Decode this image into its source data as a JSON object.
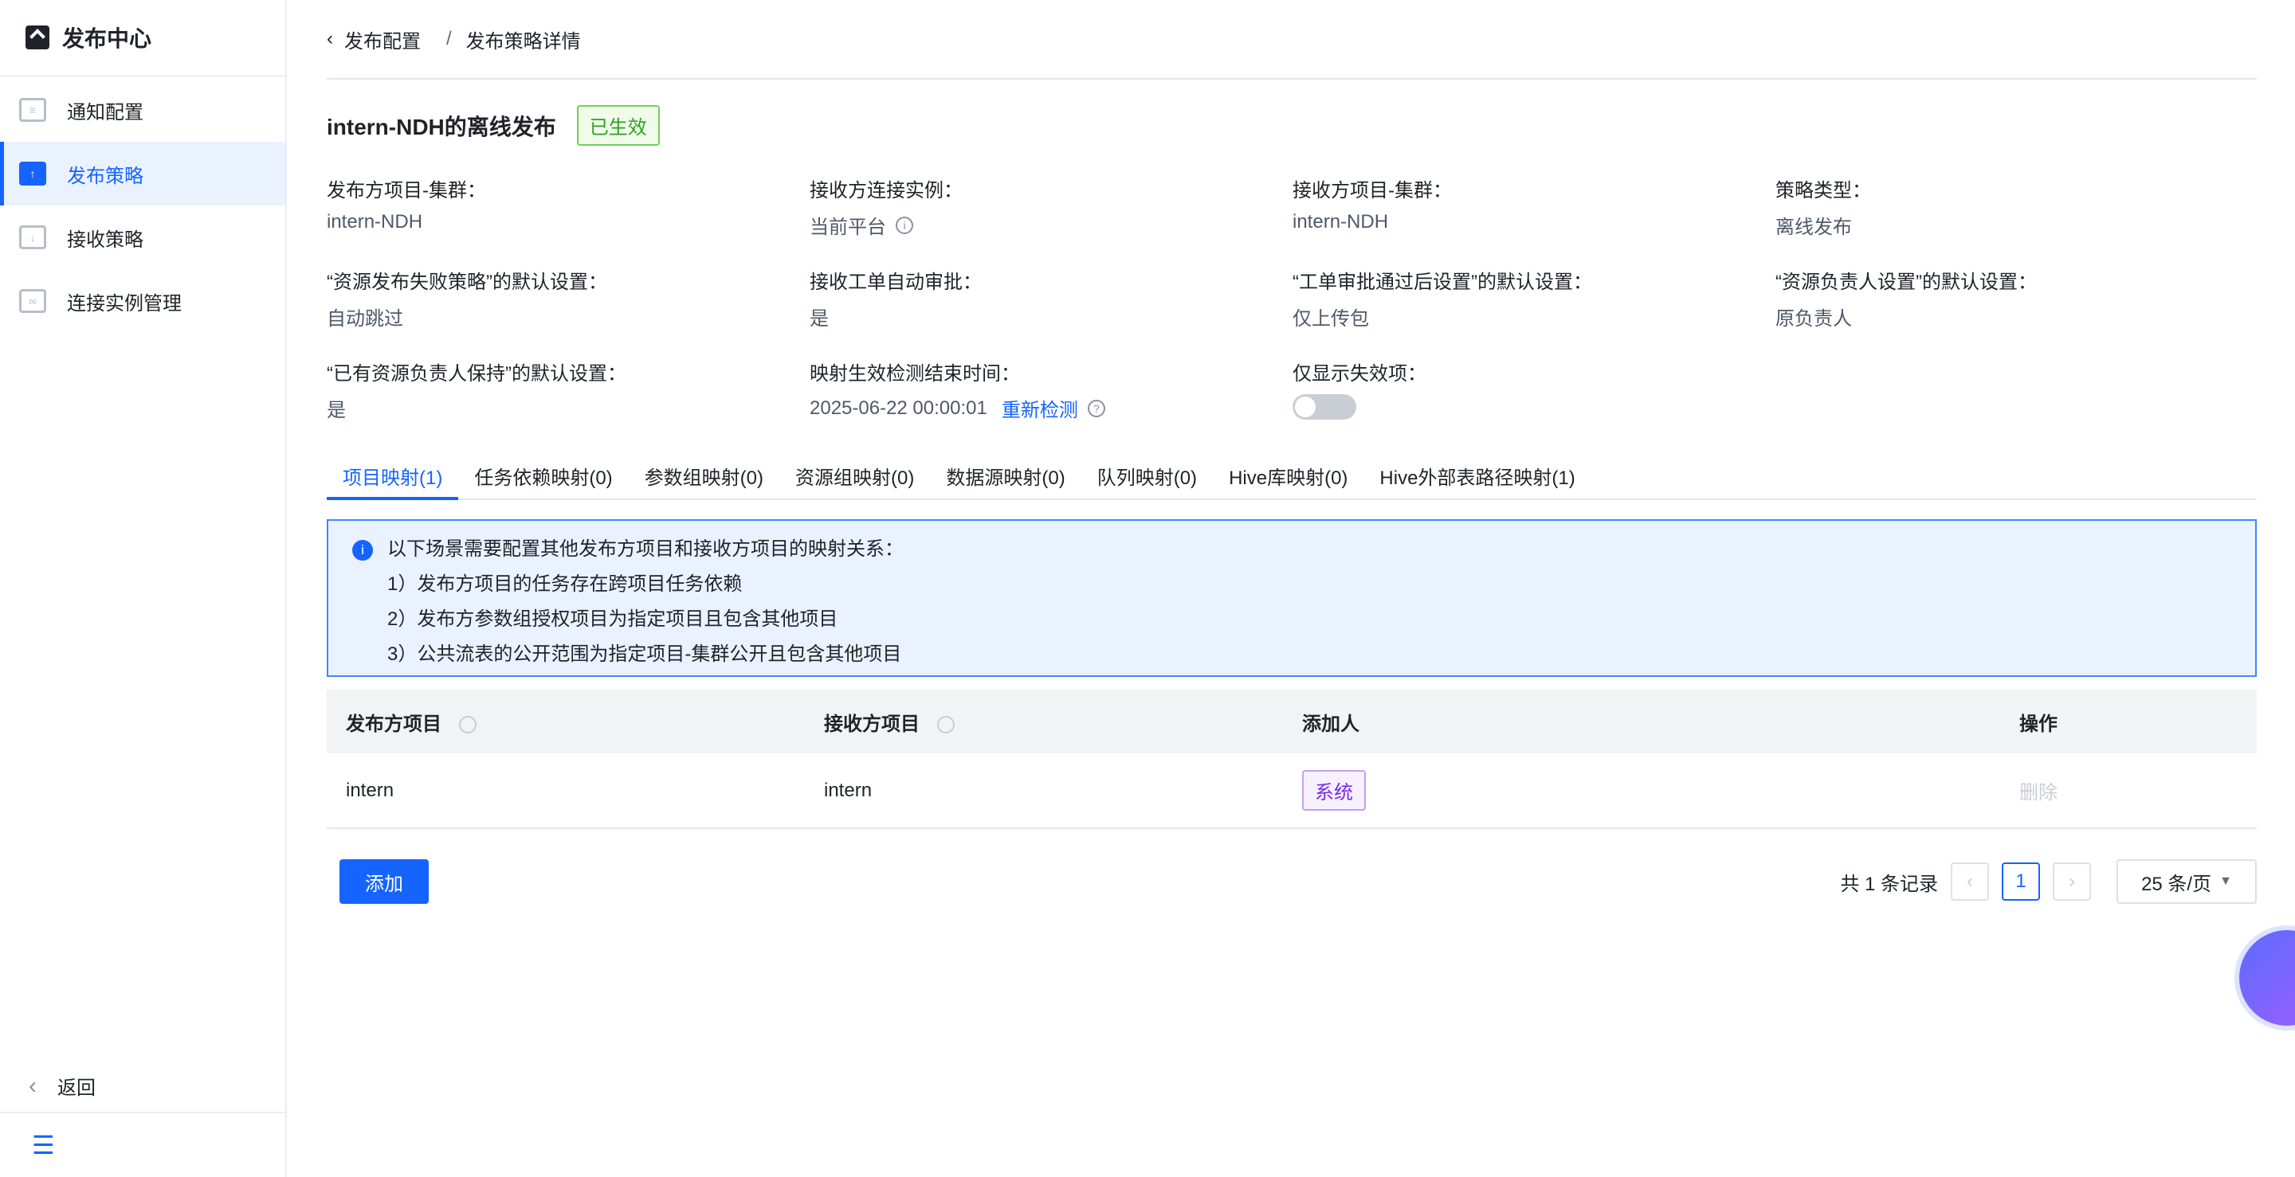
{
  "app": {
    "title": "发布中心"
  },
  "sidebar": {
    "items": [
      {
        "label": "通知配置",
        "icon": "notice-icon"
      },
      {
        "label": "发布策略",
        "icon": "publish-icon"
      },
      {
        "label": "接收策略",
        "icon": "receive-icon"
      },
      {
        "label": "连接实例管理",
        "icon": "link-icon"
      }
    ],
    "back": "返回"
  },
  "breadcrumb": {
    "parent": "发布配置",
    "sep": "/",
    "current": "发布策略详情"
  },
  "page": {
    "title": "intern-NDH的离线发布",
    "status": "已生效"
  },
  "fields": [
    {
      "label": "发布方项目-集群：",
      "value": "intern-NDH"
    },
    {
      "label": "接收方连接实例：",
      "value": "当前平台"
    },
    {
      "label": "接收方项目-集群：",
      "value": "intern-NDH"
    },
    {
      "label": "策略类型：",
      "value": "离线发布"
    },
    {
      "label": "“资源发布失败策略”的默认设置：",
      "value": "自动跳过"
    },
    {
      "label": "接收工单自动审批：",
      "value": "是"
    },
    {
      "label": "“工单审批通过后设置”的默认设置：",
      "value": "仅上传包"
    },
    {
      "label": "“资源负责人设置”的默认设置：",
      "value": "原负责人"
    },
    {
      "label": "“已有资源负责人保持”的默认设置：",
      "value": "是"
    },
    {
      "label": "映射生效检测结束时间：",
      "value": "2025-06-22 00:00:01",
      "link": "重新检测"
    },
    {
      "label": "仅显示失效项：",
      "toggle": false
    }
  ],
  "tabs": [
    "项目映射(1)",
    "任务依赖映射(0)",
    "参数组映射(0)",
    "资源组映射(0)",
    "数据源映射(0)",
    "队列映射(0)",
    "Hive库映射(0)",
    "Hive外部表路径映射(1)"
  ],
  "alert": {
    "title": "以下场景需要配置其他发布方项目和接收方项目的映射关系：",
    "items": [
      "1）发布方项目的任务存在跨项目任务依赖",
      "2）发布方参数组授权项目为指定项目且包含其他项目",
      "3）公共流表的公开范围为指定项目-集群公开且包含其他项目"
    ]
  },
  "table": {
    "headers": [
      "发布方项目",
      "接收方项目",
      "添加人",
      "操作"
    ],
    "rows": [
      {
        "src": "intern",
        "dst": "intern",
        "adder": "系统",
        "action": "删除"
      }
    ]
  },
  "footer": {
    "add": "添加",
    "total": "共 1 条记录",
    "page": "1",
    "size": "25 条/页"
  }
}
